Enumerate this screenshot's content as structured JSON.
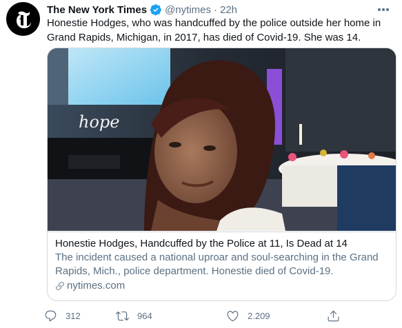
{
  "account": {
    "display_name": "The New York Times",
    "handle": "@nytimes",
    "separator": "·",
    "time": "22h",
    "verified": true,
    "avatar_icon": "nyt-t-logo-icon"
  },
  "tweet": {
    "text": "Honestie Hodges, who was handcuffed by the police outside her home in Grand Rapids, Michigan, in 2017, has died of Covid-19. She was 14."
  },
  "card": {
    "image_icon": "article-photo",
    "title": "Honestie Hodges, Handcuffed by the Police at 11, Is Dead at 14",
    "description": "The incident caused a national uproar and soul-searching in the Grand Rapids, Mich., police department. Honestie died of Covid-19.",
    "domain": "nytimes.com",
    "domain_icon": "link-icon"
  },
  "actions": {
    "reply": {
      "icon": "reply-icon",
      "count": "312"
    },
    "retweet": {
      "icon": "retweet-icon",
      "count": "964"
    },
    "like": {
      "icon": "like-icon",
      "count": "2.209"
    },
    "share": {
      "icon": "share-icon"
    }
  },
  "colors": {
    "verified": "#1da1f2",
    "secondary_text": "#5b7083",
    "border": "#cfd9de"
  }
}
